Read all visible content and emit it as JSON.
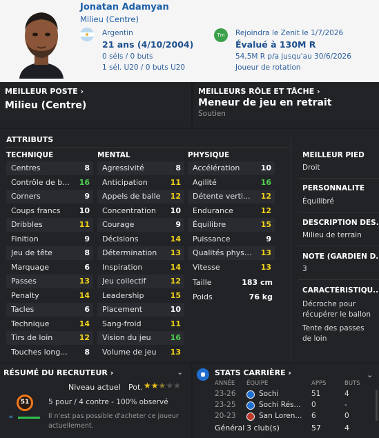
{
  "header": {
    "name": "Jonatan Adamyan",
    "position": "Milieu (Centre)",
    "nationality": "Argentin",
    "age": "21 ans (4/10/2004)",
    "caps": "0 séls / 0 buts",
    "u20": "1 sél. U20 / 0 buts U20",
    "club_badge": "Tm",
    "join": "Rejoindra le Zenit le 1/7/2026",
    "value": "Évalué à 130M R",
    "wage": "54,5M R p/a jusqu'au 30/6/2026",
    "role": "Joueur de rotation"
  },
  "best_position": {
    "title": "MEILLEUR POSTE ›",
    "value": "Milieu (Centre)"
  },
  "best_role": {
    "title": "MEILLEURS RÔLE ET TÂCHE ›",
    "value": "Meneur de jeu en retrait",
    "duty": "Soutien"
  },
  "attributes": {
    "title": "ATTRIBUTS",
    "technique": {
      "label": "TECHNIQUE",
      "items": [
        {
          "name": "Centres",
          "value": "8",
          "c": "w"
        },
        {
          "name": "Contrôle de b...",
          "value": "16",
          "c": "g"
        },
        {
          "name": "Corners",
          "value": "9",
          "c": "w"
        },
        {
          "name": "Coups francs",
          "value": "10",
          "c": "w"
        },
        {
          "name": "Dribbles",
          "value": "11",
          "c": "y"
        },
        {
          "name": "Finition",
          "value": "9",
          "c": "w"
        },
        {
          "name": "Jeu de tête",
          "value": "8",
          "c": "w"
        },
        {
          "name": "Marquage",
          "value": "6",
          "c": "w"
        },
        {
          "name": "Passes",
          "value": "13",
          "c": "y"
        },
        {
          "name": "Penalty",
          "value": "14",
          "c": "y"
        },
        {
          "name": "Tacles",
          "value": "6",
          "c": "w"
        },
        {
          "name": "Technique",
          "value": "14",
          "c": "y"
        },
        {
          "name": "Tirs de loin",
          "value": "12",
          "c": "y"
        },
        {
          "name": "Touches long...",
          "value": "8",
          "c": "w"
        }
      ]
    },
    "mental": {
      "label": "MENTAL",
      "items": [
        {
          "name": "Agressivité",
          "value": "8",
          "c": "w"
        },
        {
          "name": "Anticipation",
          "value": "11",
          "c": "y"
        },
        {
          "name": "Appels de balle",
          "value": "12",
          "c": "y"
        },
        {
          "name": "Concentration",
          "value": "10",
          "c": "w"
        },
        {
          "name": "Courage",
          "value": "9",
          "c": "w"
        },
        {
          "name": "Décisions",
          "value": "14",
          "c": "y"
        },
        {
          "name": "Détermination",
          "value": "13",
          "c": "y"
        },
        {
          "name": "Inspiration",
          "value": "14",
          "c": "y"
        },
        {
          "name": "Jeu collectif",
          "value": "12",
          "c": "y"
        },
        {
          "name": "Leadership",
          "value": "15",
          "c": "y"
        },
        {
          "name": "Placement",
          "value": "10",
          "c": "w"
        },
        {
          "name": "Sang-froid",
          "value": "11",
          "c": "y"
        },
        {
          "name": "Vision du jeu",
          "value": "16",
          "c": "g"
        },
        {
          "name": "Volume de jeu",
          "value": "13",
          "c": "y"
        }
      ]
    },
    "physique": {
      "label": "PHYSIQUE",
      "items": [
        {
          "name": "Accélération",
          "value": "10",
          "c": "w"
        },
        {
          "name": "Agilité",
          "value": "16",
          "c": "g"
        },
        {
          "name": "Détente verti...",
          "value": "12",
          "c": "y"
        },
        {
          "name": "Endurance",
          "value": "12",
          "c": "y"
        },
        {
          "name": "Équilibre",
          "value": "15",
          "c": "y"
        },
        {
          "name": "Puissance",
          "value": "9",
          "c": "w"
        },
        {
          "name": "Qualités phys...",
          "value": "13",
          "c": "y"
        },
        {
          "name": "Vitesse",
          "value": "13",
          "c": "y"
        }
      ],
      "height_label": "Taille",
      "height": "183 cm",
      "weight_label": "Poids",
      "weight": "76 kg"
    }
  },
  "side": {
    "foot_title": "MEILLEUR PIED",
    "foot": "Droit",
    "personality_title": "PERSONNALITÉ",
    "personality": "Équilibré",
    "desc_title": "DESCRIPTION DES...",
    "desc": "Milieu de terrain",
    "gk_title": "NOTE (GARDIEN D...",
    "gk": "3",
    "traits_title": "CARACTÉRISTIQU...",
    "trait1": "Décroche pour récupérer le ballon",
    "trait2": "Tente des passes de loin"
  },
  "scout": {
    "title": "RÉSUMÉ DU RECRUTEUR ›",
    "current": "Niveau actuel",
    "potential": "Pot.",
    "potential_stars": 2.5,
    "score": "51",
    "observed": "5 pour / 4 contre - 100% observé",
    "note": "Il n'est pas possible d'acheter ce joueur actuellement.",
    "accent": "#f07a1a"
  },
  "career": {
    "title": "STATS CARRIÈRE ›",
    "headers": [
      "ANNÉE",
      "ÉQUIPE",
      "APPS",
      "BUTS"
    ],
    "rows": [
      {
        "year": "23-26",
        "team": "Sochi",
        "apps": "51",
        "goals": "4"
      },
      {
        "year": "23-25",
        "team": "Sochi Rés...",
        "apps": "0",
        "goals": "-"
      },
      {
        "year": "20-23",
        "team": "San Loren...",
        "apps": "6",
        "goals": "0"
      }
    ],
    "total_label": "Général",
    "total_team": "3 club(s)",
    "total_apps": "57",
    "total_goals": "4"
  }
}
